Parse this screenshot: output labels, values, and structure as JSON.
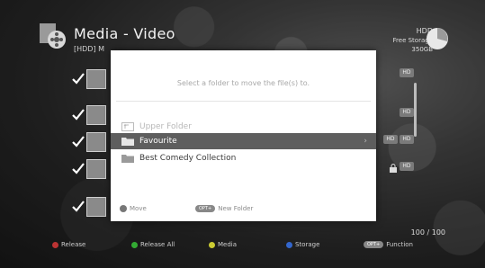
{
  "header": {
    "title": "Media - Video",
    "subtitle": "[HDD] M",
    "storage_device": "HDD",
    "storage_label": "Free Storage",
    "storage_value": "350GB"
  },
  "list": {
    "tag_hd": "HD",
    "counter": "100 / 100"
  },
  "modal": {
    "prompt": "Select a folder to move the file(s) to.",
    "folders": [
      {
        "label": "Upper Folder"
      },
      {
        "label": "Favourite"
      },
      {
        "label": "Best Comedy Collection"
      }
    ],
    "selected_chevron": "›",
    "footer": {
      "move_label": "Move",
      "new_folder_key": "OPT+",
      "new_folder_label": "New Folder"
    }
  },
  "footer_bar": {
    "items": [
      {
        "label": "Release",
        "color": "#b33"
      },
      {
        "label": "Release All",
        "color": "#3a3"
      },
      {
        "label": "Media",
        "color": "#cc3"
      },
      {
        "label": "Storage",
        "color": "#36c"
      },
      {
        "key": "OPT+",
        "label": "Function"
      }
    ]
  }
}
